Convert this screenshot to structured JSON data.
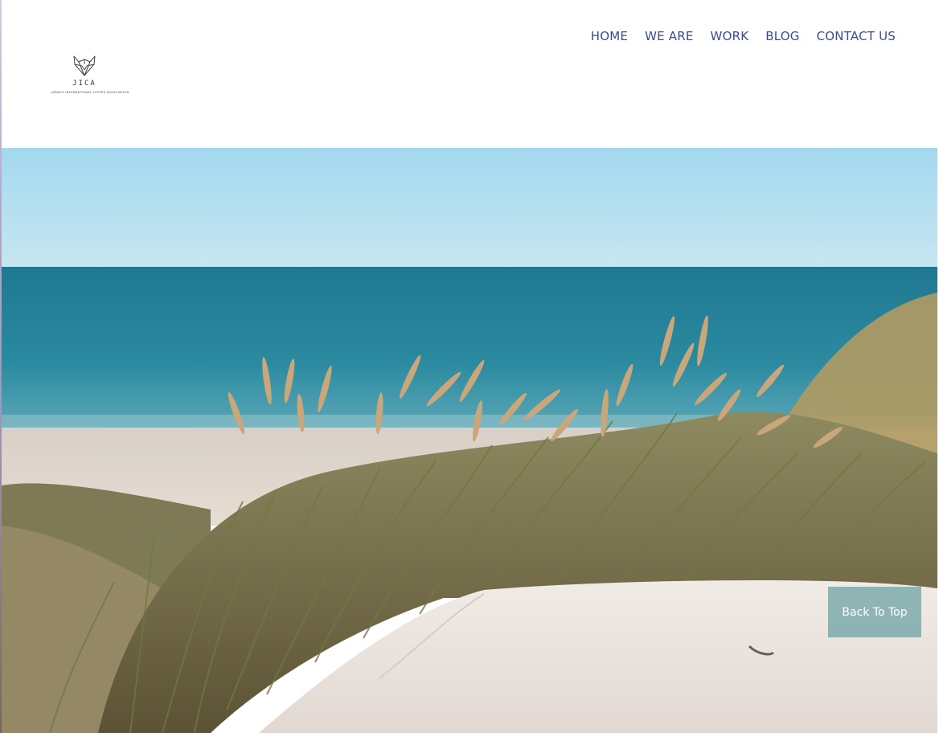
{
  "logo": {
    "name": "JICA",
    "tagline": "JAPAN'S INTERNATIONAL COFFEE ASSOCIATION",
    "icon": "geometric-fox-head-icon"
  },
  "nav": {
    "items": [
      {
        "label": "HOME"
      },
      {
        "label": "WE ARE"
      },
      {
        "label": "WORK"
      },
      {
        "label": "BLOG"
      },
      {
        "label": "CONTACT US"
      }
    ]
  },
  "hero": {
    "image": "beach-dunes-with-grass-and-sea"
  },
  "back_to_top": {
    "label": "Back To Top"
  },
  "colors": {
    "nav_text": "#3d4a8f",
    "back_to_top_bg": "#7daaac",
    "sky": "#a9d6ea",
    "sea": "#2b8398",
    "sand": "#e9e2da"
  }
}
